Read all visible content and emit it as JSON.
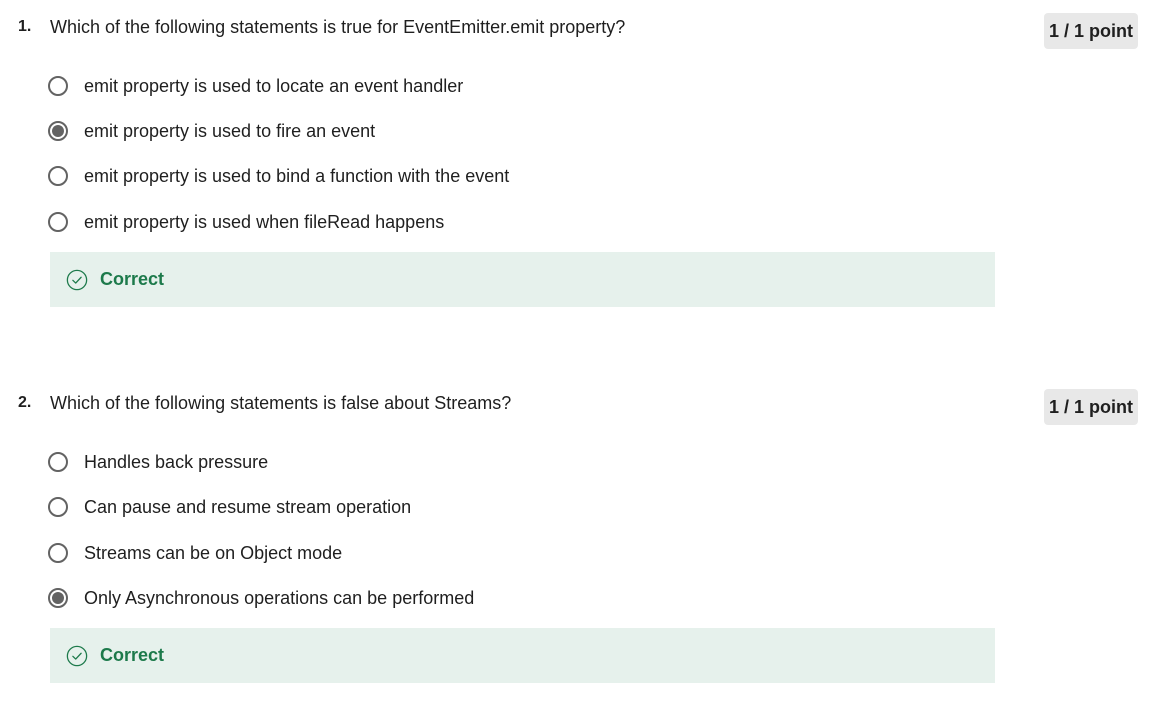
{
  "questions": [
    {
      "number": "1.",
      "text": "Which of the following statements is true for EventEmitter.emit property?",
      "points": "1 / 1 point",
      "options": [
        {
          "label": "emit property is used to locate an event handler",
          "selected": false
        },
        {
          "label": "emit property is used to fire an event",
          "selected": true
        },
        {
          "label": "emit property is used to bind a function with the event",
          "selected": false
        },
        {
          "label": "emit property is used when fileRead happens",
          "selected": false
        }
      ],
      "feedback": "Correct"
    },
    {
      "number": "2.",
      "text": "Which of the following statements is false about Streams?",
      "points": "1 / 1 point",
      "options": [
        {
          "label": "Handles back pressure",
          "selected": false
        },
        {
          "label": "Can pause and resume stream operation",
          "selected": false
        },
        {
          "label": "Streams can be on Object mode",
          "selected": false
        },
        {
          "label": "Only Asynchronous operations can be performed",
          "selected": true
        }
      ],
      "feedback": "Correct"
    }
  ],
  "colors": {
    "correct_text": "#1d7a4b",
    "correct_bg": "#e6f1ec",
    "badge_bg": "#e8e8e8",
    "radio": "#636363"
  },
  "icons": {
    "feedback": "check-circle-icon"
  }
}
